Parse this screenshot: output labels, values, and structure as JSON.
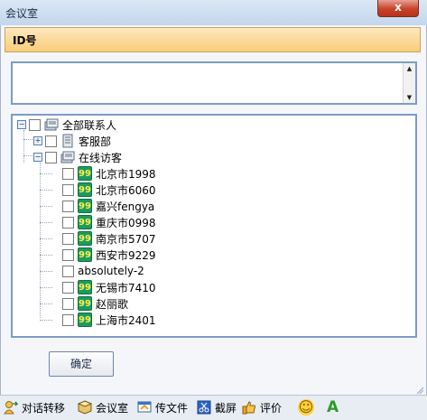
{
  "window": {
    "title": "会议室",
    "close_label": "x"
  },
  "id_section": {
    "label": "ID号",
    "value": ""
  },
  "tree": {
    "root": {
      "label": "全部联系人",
      "expander": "−"
    },
    "groups": [
      {
        "label": "客服部",
        "expander": "+"
      },
      {
        "label": "在线访客",
        "expander": "−"
      }
    ],
    "visitors": [
      {
        "label": "北京市1998",
        "has_icon": true
      },
      {
        "label": "北京市6060",
        "has_icon": true
      },
      {
        "label": "嘉兴fengya",
        "has_icon": true
      },
      {
        "label": "重庆市0998",
        "has_icon": true
      },
      {
        "label": "南京市5707",
        "has_icon": true
      },
      {
        "label": "西安市9229",
        "has_icon": true
      },
      {
        "label": "absolutely-2",
        "has_icon": false
      },
      {
        "label": "无锡市7410",
        "has_icon": true
      },
      {
        "label": "赵丽歌",
        "has_icon": true
      },
      {
        "label": "上海市2401",
        "has_icon": true
      }
    ],
    "icon_glyph": "99"
  },
  "confirm_label": "确定",
  "toolbar": {
    "transfer": "对话转移",
    "meeting": "会议室",
    "send_file": "传文件",
    "screenshot": "截屏",
    "rate": "评价",
    "emoji": "☺",
    "font": "A"
  },
  "colors": {
    "accent": "#7d9cc6",
    "header": "#f9cd7a",
    "qq_green": "#1e9b5f"
  }
}
